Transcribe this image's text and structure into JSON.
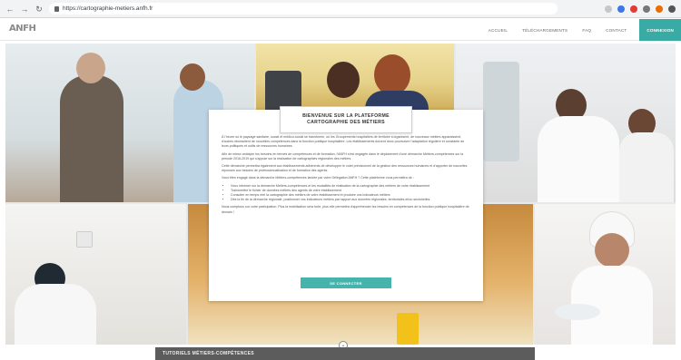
{
  "browser": {
    "back_icon": "back-arrow-icon",
    "forward_icon": "forward-arrow-icon",
    "reload_icon": "reload-icon",
    "url": "https://cartographie-metiers.anfh.fr"
  },
  "header": {
    "logo_text": "ANFH",
    "nav": [
      "ACCUEIL",
      "TÉLÉCHARGEMENTS",
      "FAQ",
      "CONTACT"
    ],
    "connect_label": "CONNEXION",
    "accent_color": "#3aaaa5"
  },
  "modal": {
    "title_line1": "BIENVENUE SUR LA PLATEFORME",
    "title_line2": "CARTOGRAPHIE DES MÉTIERS",
    "paragraphs": [
      "À l'heure où le paysage sanitaire, social et médico-social se transforme, où les Groupements hospitaliers de territoire s'organisent, de nouveaux métiers apparaissent, d'autres nécessitent de nouvelles compétences dans la fonction publique hospitalière. Les établissements doivent donc poursuivre l'adaptation régulière et constante de leurs politiques et outils de ressources humaines.",
      "Afin de mieux anticiper les besoins en termes de compétences et de formation, l'ANFH s'est engagée dans le déploiement d'une démarche Métiers-compétences sur la période 2016-2019 qui s'appuie sur la réalisation de cartographies régionales des métiers.",
      "Cette démarche permettra également aux établissements adhérents de développer le volet prévisionnel de la gestion des ressources humaines et d'apporter de nouvelles réponses aux besoins de professionnalisation et de formation des agents.",
      "Vous êtes engagé dans la démarche Métiers-compétences lancée par votre Délégation ANFH ? Cette plateforme vous permettra de :"
    ],
    "list": [
      "Vous informer sur la démarche Métiers-compétences et les modalités de réalisation de la cartographie des métiers de votre établissement",
      "Transmettre le fichier de données métiers des agents de votre établissement",
      "Consulter en temps réel la cartographie des métiers de votre établissement et produire vos indicateurs métiers",
      "Dès la fin de la démarche régionale, positionner vos indicateurs métiers par rapport aux données régionales, territoriales et/ou sectorielles."
    ],
    "closing": "Nous comptons sur votre participation. Plus la mobilisation sera forte, plus elle permettra d'appréhender les besoins en compétences de la fonction publique hospitalière de demain !",
    "button_label": "SE CONNECTER"
  },
  "footer": {
    "band_title": "TUTORIELS MÉTIERS-COMPÉTENCES",
    "scroll_icon": "chevron-down-icon"
  }
}
